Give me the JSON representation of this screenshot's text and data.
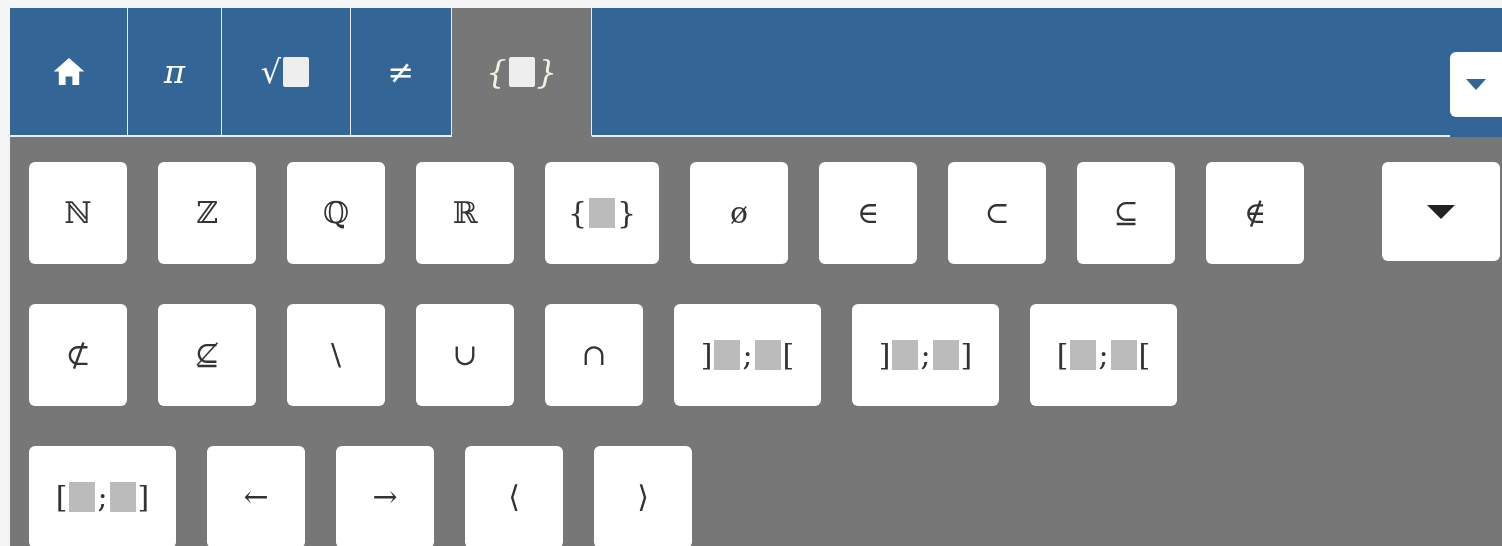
{
  "tabs": [
    {
      "kind": "home",
      "selected": false
    },
    {
      "kind": "symbol",
      "selected": false,
      "parts": [
        {
          "kind": "text",
          "text": "π"
        }
      ]
    },
    {
      "kind": "symbol",
      "selected": false,
      "parts": [
        {
          "kind": "text",
          "text": "√"
        },
        {
          "kind": "slot"
        }
      ]
    },
    {
      "kind": "symbol",
      "selected": false,
      "parts": [
        {
          "kind": "text",
          "text": "≠"
        }
      ]
    },
    {
      "kind": "symbol",
      "selected": true,
      "parts": [
        {
          "kind": "text",
          "text": "{"
        },
        {
          "kind": "slot"
        },
        {
          "kind": "text",
          "text": "}"
        }
      ]
    }
  ],
  "rows": [
    [
      {
        "kind": "symbol",
        "parts": [
          {
            "kind": "text",
            "text": "ℕ"
          }
        ]
      },
      {
        "kind": "symbol",
        "parts": [
          {
            "kind": "text",
            "text": "ℤ"
          }
        ]
      },
      {
        "kind": "symbol",
        "parts": [
          {
            "kind": "text",
            "text": "ℚ"
          }
        ]
      },
      {
        "kind": "symbol",
        "parts": [
          {
            "kind": "text",
            "text": "ℝ"
          }
        ]
      },
      {
        "kind": "set",
        "parts": [
          {
            "kind": "text",
            "text": "{"
          },
          {
            "kind": "slot"
          },
          {
            "kind": "text",
            "text": "}"
          }
        ]
      },
      {
        "kind": "symbol",
        "parts": [
          {
            "kind": "text",
            "text": "ø"
          }
        ]
      },
      {
        "kind": "symbol",
        "parts": [
          {
            "kind": "text",
            "text": "∈"
          }
        ]
      },
      {
        "kind": "symbol",
        "parts": [
          {
            "kind": "text",
            "text": "⊂"
          }
        ]
      },
      {
        "kind": "symbol",
        "parts": [
          {
            "kind": "text",
            "text": "⊆"
          }
        ]
      },
      {
        "kind": "symbol",
        "parts": [
          {
            "kind": "text",
            "text": "∉"
          }
        ]
      },
      {
        "kind": "more"
      }
    ],
    [
      {
        "kind": "symbol",
        "parts": [
          {
            "kind": "text",
            "text": "⊄"
          }
        ]
      },
      {
        "kind": "symbol",
        "parts": [
          {
            "kind": "text",
            "text": "⊈"
          }
        ]
      },
      {
        "kind": "symbol",
        "parts": [
          {
            "kind": "text",
            "text": "\\"
          }
        ]
      },
      {
        "kind": "symbol",
        "parts": [
          {
            "kind": "text",
            "text": "∪"
          }
        ]
      },
      {
        "kind": "symbol",
        "parts": [
          {
            "kind": "text",
            "text": "∩"
          }
        ]
      },
      {
        "kind": "interval",
        "parts": [
          {
            "kind": "text",
            "text": "]"
          },
          {
            "kind": "slot"
          },
          {
            "kind": "text",
            "text": ";"
          },
          {
            "kind": "slot"
          },
          {
            "kind": "text",
            "text": "["
          }
        ]
      },
      {
        "kind": "interval",
        "parts": [
          {
            "kind": "text",
            "text": "]"
          },
          {
            "kind": "slot"
          },
          {
            "kind": "text",
            "text": ";"
          },
          {
            "kind": "slot"
          },
          {
            "kind": "text",
            "text": "]"
          }
        ]
      },
      {
        "kind": "interval",
        "parts": [
          {
            "kind": "text",
            "text": "["
          },
          {
            "kind": "slot"
          },
          {
            "kind": "text",
            "text": ";"
          },
          {
            "kind": "slot"
          },
          {
            "kind": "text",
            "text": "["
          }
        ]
      }
    ],
    [
      {
        "kind": "interval",
        "parts": [
          {
            "kind": "text",
            "text": "["
          },
          {
            "kind": "slot"
          },
          {
            "kind": "text",
            "text": ";"
          },
          {
            "kind": "slot"
          },
          {
            "kind": "text",
            "text": "]"
          }
        ]
      },
      {
        "kind": "symbol",
        "parts": [
          {
            "kind": "text",
            "text": "←"
          }
        ]
      },
      {
        "kind": "symbol",
        "parts": [
          {
            "kind": "text",
            "text": "→"
          }
        ]
      },
      {
        "kind": "symbol",
        "parts": [
          {
            "kind": "text",
            "text": "⟨"
          }
        ]
      },
      {
        "kind": "symbol",
        "parts": [
          {
            "kind": "text",
            "text": "⟩"
          }
        ]
      }
    ]
  ]
}
